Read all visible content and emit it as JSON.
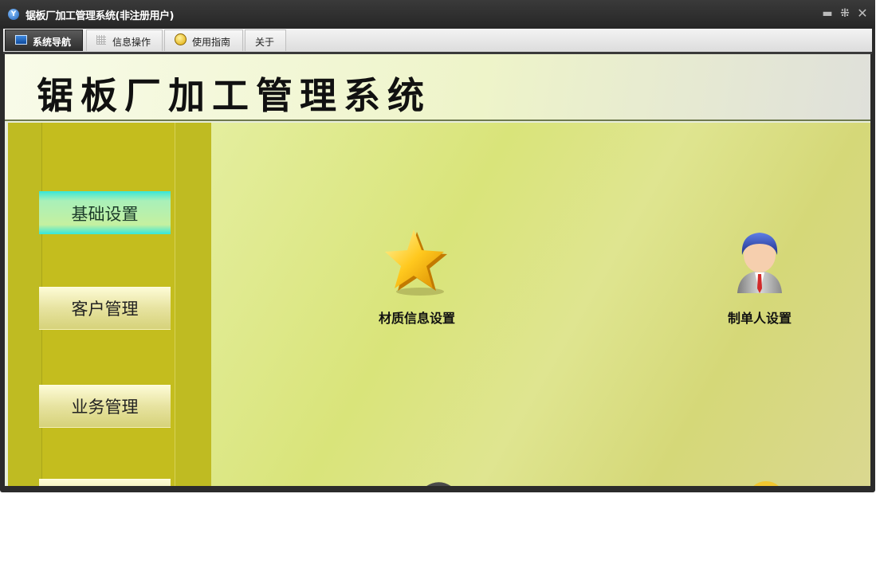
{
  "window": {
    "title": "锯板厂加工管理系统(非注册用户)",
    "logo_text": "Y",
    "controls": {
      "minimize": "▬",
      "restore": "⁜",
      "close": "✕"
    }
  },
  "tabs": [
    {
      "label": "系统导航",
      "icon": "monitor-icon",
      "active": true
    },
    {
      "label": "信息操作",
      "icon": "grid-icon",
      "active": false
    },
    {
      "label": "使用指南",
      "icon": "help-icon",
      "active": false
    },
    {
      "label": "关于",
      "icon": "",
      "active": false
    }
  ],
  "header": {
    "title": "锯板厂加工管理系统"
  },
  "sidebar": {
    "items": [
      {
        "label": "基础设置",
        "active": true
      },
      {
        "label": "客户管理",
        "active": false
      },
      {
        "label": "业务管理",
        "active": false
      },
      {
        "label": "",
        "active": false
      }
    ]
  },
  "panel": {
    "tiles": [
      {
        "label": "材质信息设置",
        "icon": "star-icon"
      },
      {
        "label": "制单人设置",
        "icon": "person-icon"
      },
      {
        "label": "",
        "icon": "partial-icon-c"
      },
      {
        "label": "",
        "icon": "partial-icon-d"
      }
    ]
  },
  "colors": {
    "sidebar": "#bfbb22",
    "active_nav": "#4de8d0",
    "panel": "#dfe590",
    "titlebar": "#2b2b2b"
  }
}
